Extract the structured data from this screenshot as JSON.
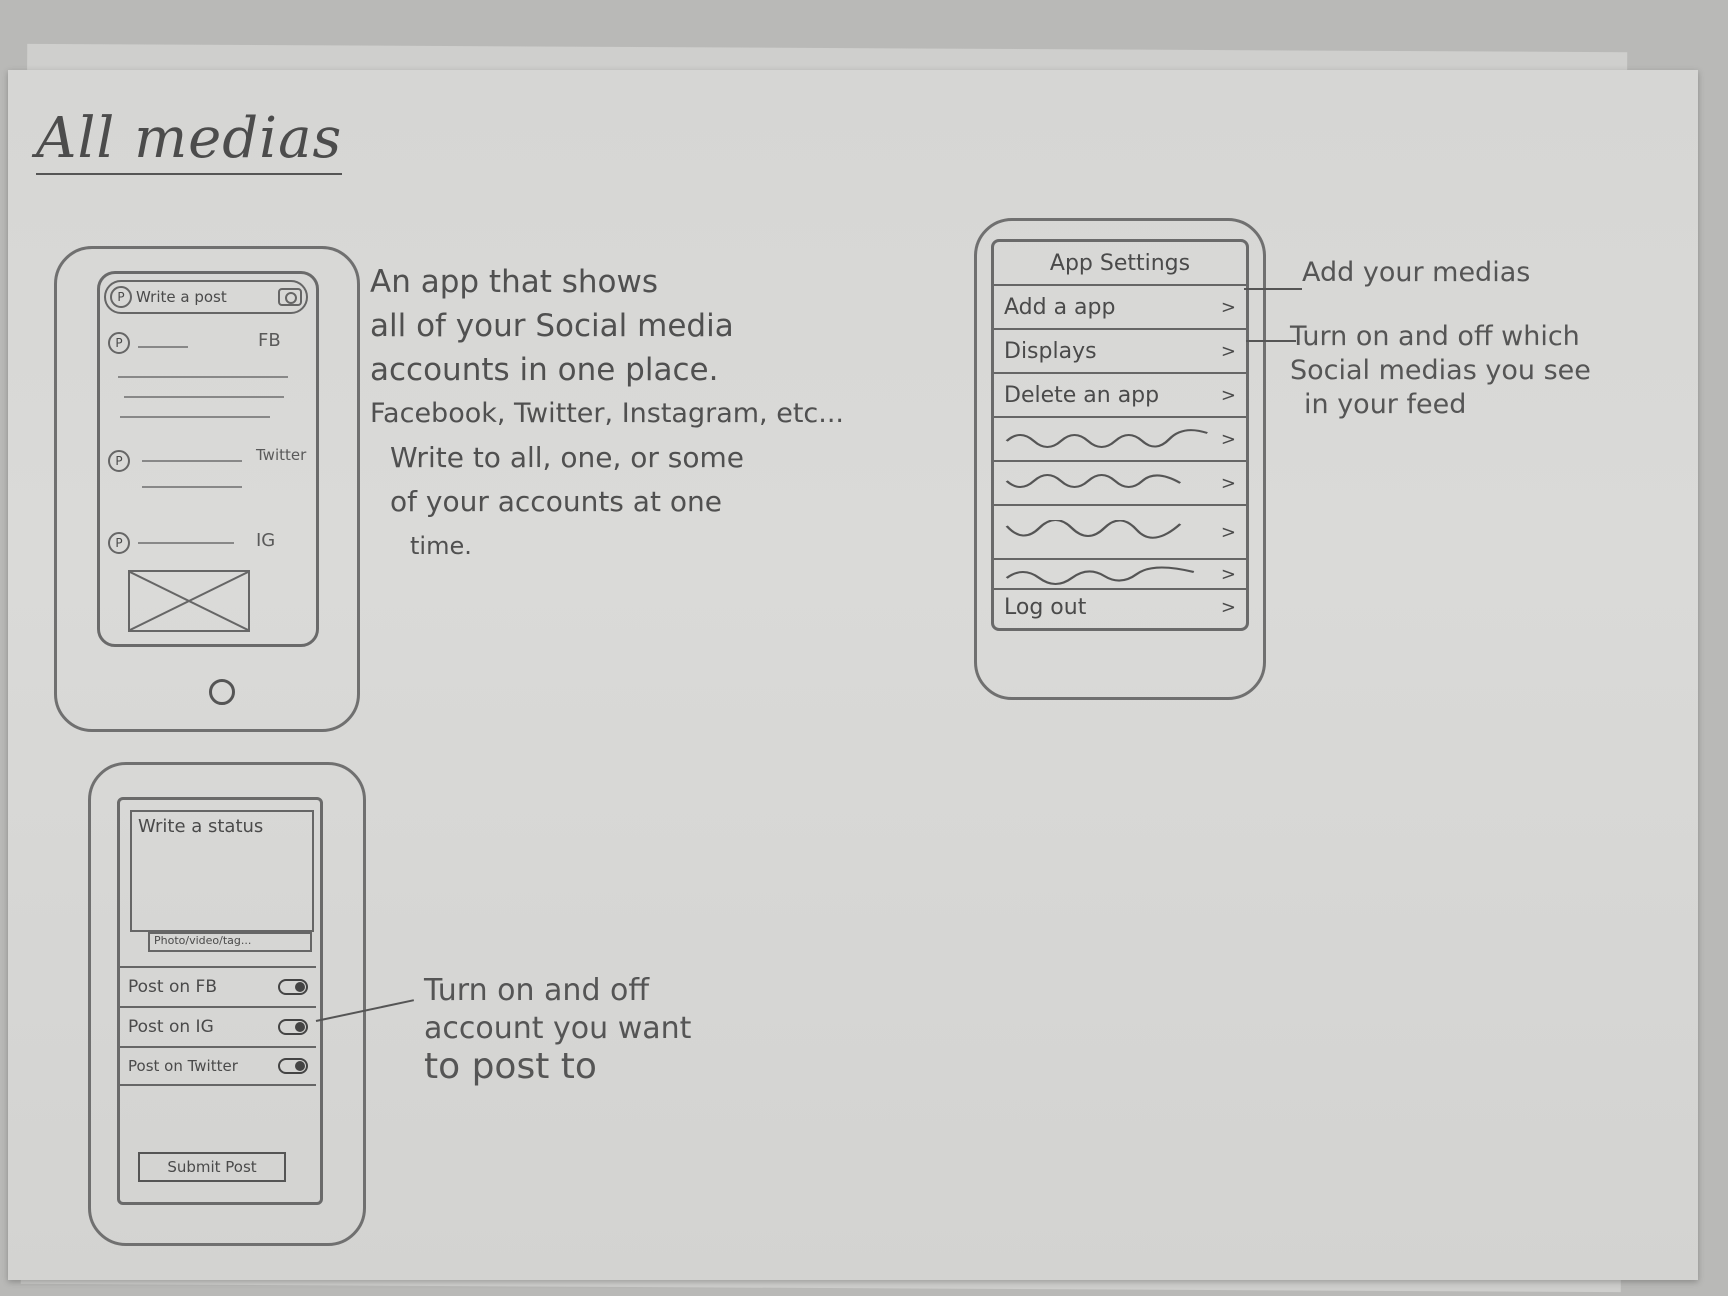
{
  "title": "All medias",
  "description": [
    "An app that shows",
    "all of your Social media",
    "accounts in one place.",
    "Facebook, Twitter, Instagram, etc...",
    "Write to all, one, or some",
    "of your accounts at one",
    "time."
  ],
  "feed_screen": {
    "write_button": "Write a post",
    "feed_tags": [
      "FB",
      "Twitter",
      "IG"
    ]
  },
  "post_screen": {
    "status_placeholder": "Write a status",
    "media_bar": "Photo/video/tag...",
    "toggles": [
      "Post on FB",
      "Post on IG",
      "Post on Twitter"
    ],
    "submit": "Submit Post"
  },
  "settings_screen": {
    "title": "App Settings",
    "rows": [
      "Add a app",
      "Displays",
      "Delete an app"
    ],
    "logout": "Log out",
    "chevron": ">"
  },
  "annotations": {
    "add_medias": "Add your medias",
    "displays": [
      "Turn on and off which",
      "Social medias you see",
      "in your feed"
    ],
    "toggles": [
      "Turn on and off",
      "account you want",
      "to post to"
    ]
  }
}
